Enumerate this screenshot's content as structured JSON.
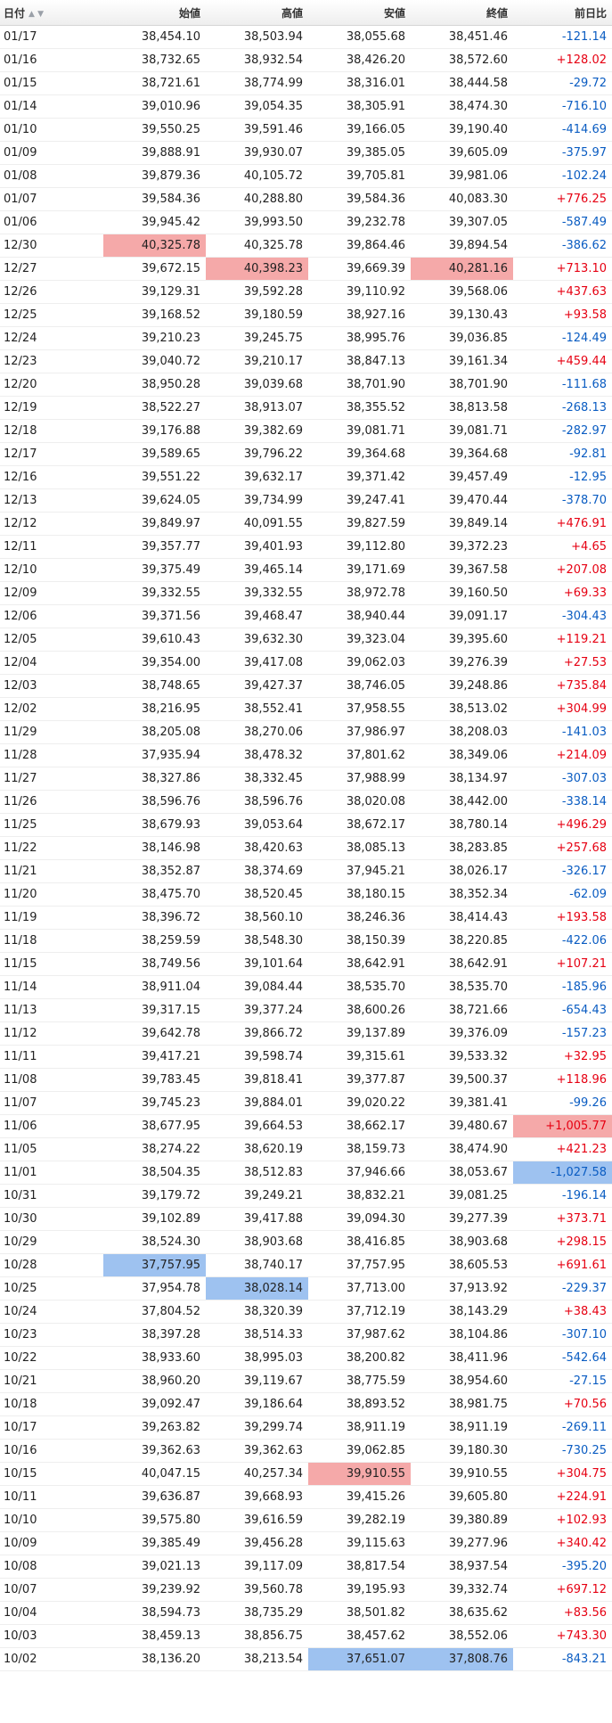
{
  "header": {
    "date": "日付",
    "open": "始値",
    "high": "高値",
    "low": "安値",
    "close": "終値",
    "change": "前日比"
  },
  "colors": {
    "highlight_high": "#f5a9a9",
    "highlight_low": "#9ec2f0",
    "positive": "#e60012",
    "negative": "#0a5cc2"
  },
  "rows": [
    {
      "date": "01/17",
      "open": "38,454.10",
      "high": "38,503.94",
      "low": "38,055.68",
      "close": "38,451.46",
      "change": "-121.14"
    },
    {
      "date": "01/16",
      "open": "38,732.65",
      "high": "38,932.54",
      "low": "38,426.20",
      "close": "38,572.60",
      "change": "+128.02"
    },
    {
      "date": "01/15",
      "open": "38,721.61",
      "high": "38,774.99",
      "low": "38,316.01",
      "close": "38,444.58",
      "change": "-29.72"
    },
    {
      "date": "01/14",
      "open": "39,010.96",
      "high": "39,054.35",
      "low": "38,305.91",
      "close": "38,474.30",
      "change": "-716.10"
    },
    {
      "date": "01/10",
      "open": "39,550.25",
      "high": "39,591.46",
      "low": "39,166.05",
      "close": "39,190.40",
      "change": "-414.69"
    },
    {
      "date": "01/09",
      "open": "39,888.91",
      "high": "39,930.07",
      "low": "39,385.05",
      "close": "39,605.09",
      "change": "-375.97"
    },
    {
      "date": "01/08",
      "open": "39,879.36",
      "high": "40,105.72",
      "low": "39,705.81",
      "close": "39,981.06",
      "change": "-102.24"
    },
    {
      "date": "01/07",
      "open": "39,584.36",
      "high": "40,288.80",
      "low": "39,584.36",
      "close": "40,083.30",
      "change": "+776.25"
    },
    {
      "date": "01/06",
      "open": "39,945.42",
      "high": "39,993.50",
      "low": "39,232.78",
      "close": "39,307.05",
      "change": "-587.49"
    },
    {
      "date": "12/30",
      "open": "40,325.78",
      "high": "40,325.78",
      "low": "39,864.46",
      "close": "39,894.54",
      "change": "-386.62",
      "hl": {
        "open": "hi"
      }
    },
    {
      "date": "12/27",
      "open": "39,672.15",
      "high": "40,398.23",
      "low": "39,669.39",
      "close": "40,281.16",
      "change": "+713.10",
      "hl": {
        "high": "hi",
        "close": "hi"
      }
    },
    {
      "date": "12/26",
      "open": "39,129.31",
      "high": "39,592.28",
      "low": "39,110.92",
      "close": "39,568.06",
      "change": "+437.63"
    },
    {
      "date": "12/25",
      "open": "39,168.52",
      "high": "39,180.59",
      "low": "38,927.16",
      "close": "39,130.43",
      "change": "+93.58"
    },
    {
      "date": "12/24",
      "open": "39,210.23",
      "high": "39,245.75",
      "low": "38,995.76",
      "close": "39,036.85",
      "change": "-124.49"
    },
    {
      "date": "12/23",
      "open": "39,040.72",
      "high": "39,210.17",
      "low": "38,847.13",
      "close": "39,161.34",
      "change": "+459.44"
    },
    {
      "date": "12/20",
      "open": "38,950.28",
      "high": "39,039.68",
      "low": "38,701.90",
      "close": "38,701.90",
      "change": "-111.68"
    },
    {
      "date": "12/19",
      "open": "38,522.27",
      "high": "38,913.07",
      "low": "38,355.52",
      "close": "38,813.58",
      "change": "-268.13"
    },
    {
      "date": "12/18",
      "open": "39,176.88",
      "high": "39,382.69",
      "low": "39,081.71",
      "close": "39,081.71",
      "change": "-282.97"
    },
    {
      "date": "12/17",
      "open": "39,589.65",
      "high": "39,796.22",
      "low": "39,364.68",
      "close": "39,364.68",
      "change": "-92.81"
    },
    {
      "date": "12/16",
      "open": "39,551.22",
      "high": "39,632.17",
      "low": "39,371.42",
      "close": "39,457.49",
      "change": "-12.95"
    },
    {
      "date": "12/13",
      "open": "39,624.05",
      "high": "39,734.99",
      "low": "39,247.41",
      "close": "39,470.44",
      "change": "-378.70"
    },
    {
      "date": "12/12",
      "open": "39,849.97",
      "high": "40,091.55",
      "low": "39,827.59",
      "close": "39,849.14",
      "change": "+476.91"
    },
    {
      "date": "12/11",
      "open": "39,357.77",
      "high": "39,401.93",
      "low": "39,112.80",
      "close": "39,372.23",
      "change": "+4.65"
    },
    {
      "date": "12/10",
      "open": "39,375.49",
      "high": "39,465.14",
      "low": "39,171.69",
      "close": "39,367.58",
      "change": "+207.08"
    },
    {
      "date": "12/09",
      "open": "39,332.55",
      "high": "39,332.55",
      "low": "38,972.78",
      "close": "39,160.50",
      "change": "+69.33"
    },
    {
      "date": "12/06",
      "open": "39,371.56",
      "high": "39,468.47",
      "low": "38,940.44",
      "close": "39,091.17",
      "change": "-304.43"
    },
    {
      "date": "12/05",
      "open": "39,610.43",
      "high": "39,632.30",
      "low": "39,323.04",
      "close": "39,395.60",
      "change": "+119.21"
    },
    {
      "date": "12/04",
      "open": "39,354.00",
      "high": "39,417.08",
      "low": "39,062.03",
      "close": "39,276.39",
      "change": "+27.53"
    },
    {
      "date": "12/03",
      "open": "38,748.65",
      "high": "39,427.37",
      "low": "38,746.05",
      "close": "39,248.86",
      "change": "+735.84"
    },
    {
      "date": "12/02",
      "open": "38,216.95",
      "high": "38,552.41",
      "low": "37,958.55",
      "close": "38,513.02",
      "change": "+304.99"
    },
    {
      "date": "11/29",
      "open": "38,205.08",
      "high": "38,270.06",
      "low": "37,986.97",
      "close": "38,208.03",
      "change": "-141.03"
    },
    {
      "date": "11/28",
      "open": "37,935.94",
      "high": "38,478.32",
      "low": "37,801.62",
      "close": "38,349.06",
      "change": "+214.09"
    },
    {
      "date": "11/27",
      "open": "38,327.86",
      "high": "38,332.45",
      "low": "37,988.99",
      "close": "38,134.97",
      "change": "-307.03"
    },
    {
      "date": "11/26",
      "open": "38,596.76",
      "high": "38,596.76",
      "low": "38,020.08",
      "close": "38,442.00",
      "change": "-338.14"
    },
    {
      "date": "11/25",
      "open": "38,679.93",
      "high": "39,053.64",
      "low": "38,672.17",
      "close": "38,780.14",
      "change": "+496.29"
    },
    {
      "date": "11/22",
      "open": "38,146.98",
      "high": "38,420.63",
      "low": "38,085.13",
      "close": "38,283.85",
      "change": "+257.68"
    },
    {
      "date": "11/21",
      "open": "38,352.87",
      "high": "38,374.69",
      "low": "37,945.21",
      "close": "38,026.17",
      "change": "-326.17"
    },
    {
      "date": "11/20",
      "open": "38,475.70",
      "high": "38,520.45",
      "low": "38,180.15",
      "close": "38,352.34",
      "change": "-62.09"
    },
    {
      "date": "11/19",
      "open": "38,396.72",
      "high": "38,560.10",
      "low": "38,246.36",
      "close": "38,414.43",
      "change": "+193.58"
    },
    {
      "date": "11/18",
      "open": "38,259.59",
      "high": "38,548.30",
      "low": "38,150.39",
      "close": "38,220.85",
      "change": "-422.06"
    },
    {
      "date": "11/15",
      "open": "38,749.56",
      "high": "39,101.64",
      "low": "38,642.91",
      "close": "38,642.91",
      "change": "+107.21"
    },
    {
      "date": "11/14",
      "open": "38,911.04",
      "high": "39,084.44",
      "low": "38,535.70",
      "close": "38,535.70",
      "change": "-185.96"
    },
    {
      "date": "11/13",
      "open": "39,317.15",
      "high": "39,377.24",
      "low": "38,600.26",
      "close": "38,721.66",
      "change": "-654.43"
    },
    {
      "date": "11/12",
      "open": "39,642.78",
      "high": "39,866.72",
      "low": "39,137.89",
      "close": "39,376.09",
      "change": "-157.23"
    },
    {
      "date": "11/11",
      "open": "39,417.21",
      "high": "39,598.74",
      "low": "39,315.61",
      "close": "39,533.32",
      "change": "+32.95"
    },
    {
      "date": "11/08",
      "open": "39,783.45",
      "high": "39,818.41",
      "low": "39,377.87",
      "close": "39,500.37",
      "change": "+118.96"
    },
    {
      "date": "11/07",
      "open": "39,745.23",
      "high": "39,884.01",
      "low": "39,020.22",
      "close": "39,381.41",
      "change": "-99.26"
    },
    {
      "date": "11/06",
      "open": "38,677.95",
      "high": "39,664.53",
      "low": "38,662.17",
      "close": "39,480.67",
      "change": "+1,005.77",
      "hl": {
        "change": "hi"
      }
    },
    {
      "date": "11/05",
      "open": "38,274.22",
      "high": "38,620.19",
      "low": "38,159.73",
      "close": "38,474.90",
      "change": "+421.23"
    },
    {
      "date": "11/01",
      "open": "38,504.35",
      "high": "38,512.83",
      "low": "37,946.66",
      "close": "38,053.67",
      "change": "-1,027.58",
      "hl": {
        "change": "lo"
      }
    },
    {
      "date": "10/31",
      "open": "39,179.72",
      "high": "39,249.21",
      "low": "38,832.21",
      "close": "39,081.25",
      "change": "-196.14"
    },
    {
      "date": "10/30",
      "open": "39,102.89",
      "high": "39,417.88",
      "low": "39,094.30",
      "close": "39,277.39",
      "change": "+373.71"
    },
    {
      "date": "10/29",
      "open": "38,524.30",
      "high": "38,903.68",
      "low": "38,416.85",
      "close": "38,903.68",
      "change": "+298.15"
    },
    {
      "date": "10/28",
      "open": "37,757.95",
      "high": "38,740.17",
      "low": "37,757.95",
      "close": "38,605.53",
      "change": "+691.61",
      "hl": {
        "open": "lo"
      }
    },
    {
      "date": "10/25",
      "open": "37,954.78",
      "high": "38,028.14",
      "low": "37,713.00",
      "close": "37,913.92",
      "change": "-229.37",
      "hl": {
        "high": "lo"
      }
    },
    {
      "date": "10/24",
      "open": "37,804.52",
      "high": "38,320.39",
      "low": "37,712.19",
      "close": "38,143.29",
      "change": "+38.43"
    },
    {
      "date": "10/23",
      "open": "38,397.28",
      "high": "38,514.33",
      "low": "37,987.62",
      "close": "38,104.86",
      "change": "-307.10"
    },
    {
      "date": "10/22",
      "open": "38,933.60",
      "high": "38,995.03",
      "low": "38,200.82",
      "close": "38,411.96",
      "change": "-542.64"
    },
    {
      "date": "10/21",
      "open": "38,960.20",
      "high": "39,119.67",
      "low": "38,775.59",
      "close": "38,954.60",
      "change": "-27.15"
    },
    {
      "date": "10/18",
      "open": "39,092.47",
      "high": "39,186.64",
      "low": "38,893.52",
      "close": "38,981.75",
      "change": "+70.56"
    },
    {
      "date": "10/17",
      "open": "39,263.82",
      "high": "39,299.74",
      "low": "38,911.19",
      "close": "38,911.19",
      "change": "-269.11"
    },
    {
      "date": "10/16",
      "open": "39,362.63",
      "high": "39,362.63",
      "low": "39,062.85",
      "close": "39,180.30",
      "change": "-730.25"
    },
    {
      "date": "10/15",
      "open": "40,047.15",
      "high": "40,257.34",
      "low": "39,910.55",
      "close": "39,910.55",
      "change": "+304.75",
      "hl": {
        "low": "hi"
      }
    },
    {
      "date": "10/11",
      "open": "39,636.87",
      "high": "39,668.93",
      "low": "39,415.26",
      "close": "39,605.80",
      "change": "+224.91"
    },
    {
      "date": "10/10",
      "open": "39,575.80",
      "high": "39,616.59",
      "low": "39,282.19",
      "close": "39,380.89",
      "change": "+102.93"
    },
    {
      "date": "10/09",
      "open": "39,385.49",
      "high": "39,456.28",
      "low": "39,115.63",
      "close": "39,277.96",
      "change": "+340.42"
    },
    {
      "date": "10/08",
      "open": "39,021.13",
      "high": "39,117.09",
      "low": "38,817.54",
      "close": "38,937.54",
      "change": "-395.20"
    },
    {
      "date": "10/07",
      "open": "39,239.92",
      "high": "39,560.78",
      "low": "39,195.93",
      "close": "39,332.74",
      "change": "+697.12"
    },
    {
      "date": "10/04",
      "open": "38,594.73",
      "high": "38,735.29",
      "low": "38,501.82",
      "close": "38,635.62",
      "change": "+83.56"
    },
    {
      "date": "10/03",
      "open": "38,459.13",
      "high": "38,856.75",
      "low": "38,457.62",
      "close": "38,552.06",
      "change": "+743.30"
    },
    {
      "date": "10/02",
      "open": "38,136.20",
      "high": "38,213.54",
      "low": "37,651.07",
      "close": "37,808.76",
      "change": "-843.21",
      "hl": {
        "low": "lo",
        "close": "lo"
      }
    }
  ]
}
